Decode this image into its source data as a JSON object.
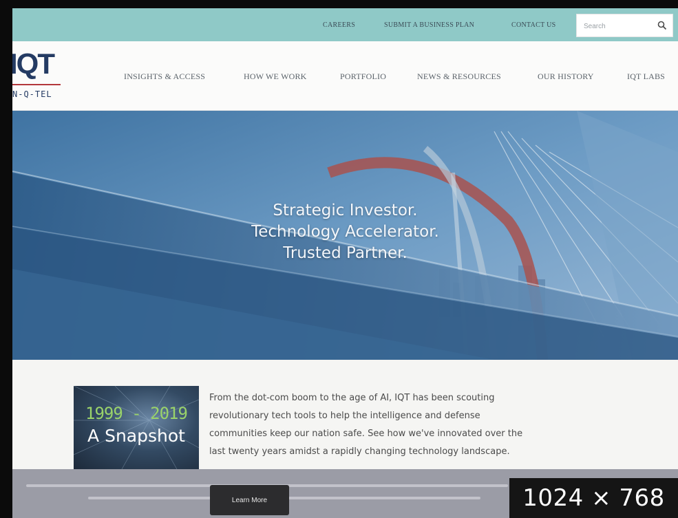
{
  "utility_bar": {
    "careers": "CAREERS",
    "submit_plan": "SUBMIT A BUSINESS PLAN",
    "contact": "CONTACT US",
    "search_placeholder": "Search"
  },
  "logo": {
    "mark": "IQT",
    "wordmark": "N-Q-TEL"
  },
  "nav": [
    "INSIGHTS & ACCESS",
    "HOW WE WORK",
    "PORTFOLIO",
    "NEWS & RESOURCES",
    "OUR HISTORY",
    "IQT LABS"
  ],
  "hero": {
    "line1": "Strategic Investor.",
    "line2": "Technology Accelerator.",
    "line3": "Trusted Partner."
  },
  "feature": {
    "thumb_years": "1999 - 2019",
    "thumb_title": "A Snapshot",
    "blurb_lines": [
      "From the dot-com boom to the age of AI, IQT has been scouting",
      "revolutionary tech tools to help the intelligence and defense",
      "communities keep our nation safe. See how we've innovated over the",
      "last twenty years amidst a rapidly changing technology landscape."
    ]
  },
  "cookie_bar": {
    "button_label": "Learn More"
  },
  "watermark": "1024 × 768",
  "colors": {
    "utility_bar": "#8fc9c7",
    "logo_navy": "#243b63",
    "logo_red": "#b3373b",
    "hero_blue": "#5b8fbb"
  }
}
